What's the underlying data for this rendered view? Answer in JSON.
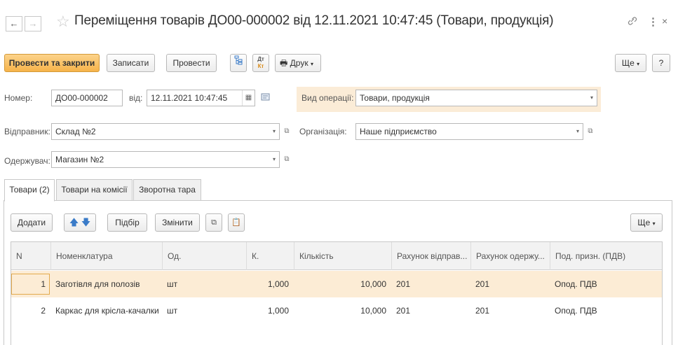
{
  "window": {
    "title": "Переміщення товарів ДО00-000002 від 12.11.2021 10:47:45 (Товари, продукція)",
    "close_glyph": "×",
    "more_glyph": "⋮"
  },
  "toolbar": {
    "post_close": "Провести та закрити",
    "save": "Записати",
    "post": "Провести",
    "print": "Друк",
    "more": "Ще",
    "help": "?"
  },
  "form": {
    "number_label": "Номер:",
    "number_value": "ДО00-000002",
    "date_label": "від:",
    "date_value": "12.11.2021 10:47:45",
    "operation_label": "Вид операції:",
    "operation_value": "Товари, продукція",
    "sender_label": "Відправник:",
    "sender_value": "Склад №2",
    "organization_label": "Організація:",
    "organization_value": "Наше підприємство",
    "receiver_label": "Одержувач:",
    "receiver_value": "Магазин №2"
  },
  "tabs": [
    {
      "label": "Товари (2)"
    },
    {
      "label": "Товари на комісії"
    },
    {
      "label": "Зворотна тара"
    }
  ],
  "table_toolbar": {
    "add": "Додати",
    "pick": "Підбір",
    "change": "Змінити",
    "more": "Ще"
  },
  "table": {
    "columns": [
      "N",
      "Номенклатура",
      "Од.",
      "К.",
      "Кількість",
      "Рахунок відправ...",
      "Рахунок одержу...",
      "Под. призн. (ПДВ)"
    ],
    "rows": [
      {
        "n": "1",
        "item": "Заготівля для полозів",
        "unit": "шт",
        "k": "1,000",
        "qty": "10,000",
        "acc_from": "201",
        "acc_to": "201",
        "vat": "Опод. ПДВ"
      },
      {
        "n": "2",
        "item": "Каркас для крісла-качалки",
        "unit": "шт",
        "k": "1,000",
        "qty": "10,000",
        "acc_from": "201",
        "acc_to": "201",
        "vat": "Опод. ПДВ"
      }
    ]
  },
  "colors": {
    "primary_button": "#f6b34a",
    "selection": "#fcecd5",
    "operation_highlight": "#fbecd7"
  }
}
